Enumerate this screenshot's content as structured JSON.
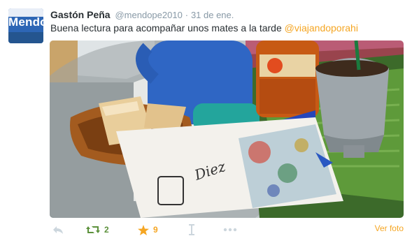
{
  "avatar": {
    "text": "Mendo"
  },
  "tweet": {
    "fullname": "Gastón Peña",
    "handle": "@mendope2010",
    "separator": "·",
    "time": "31 de ene.",
    "text": "Buena lectura para acompañar unos mates a la tarde ",
    "mention": "@viajandoporahi"
  },
  "actions": {
    "reply_icon": "reply-icon",
    "retweet_icon": "retweet-icon",
    "retweet_count": "2",
    "favorite_icon": "star-icon",
    "favorite_count": "9",
    "pin_icon": "pin-icon",
    "more_icon": "more-dots-icon",
    "view_photo": "Ver foto"
  },
  "colors": {
    "accent": "#f5a623",
    "retweet_green": "#5c913b",
    "muted": "#8899a6",
    "icon_gray": "#ccd6dd"
  }
}
